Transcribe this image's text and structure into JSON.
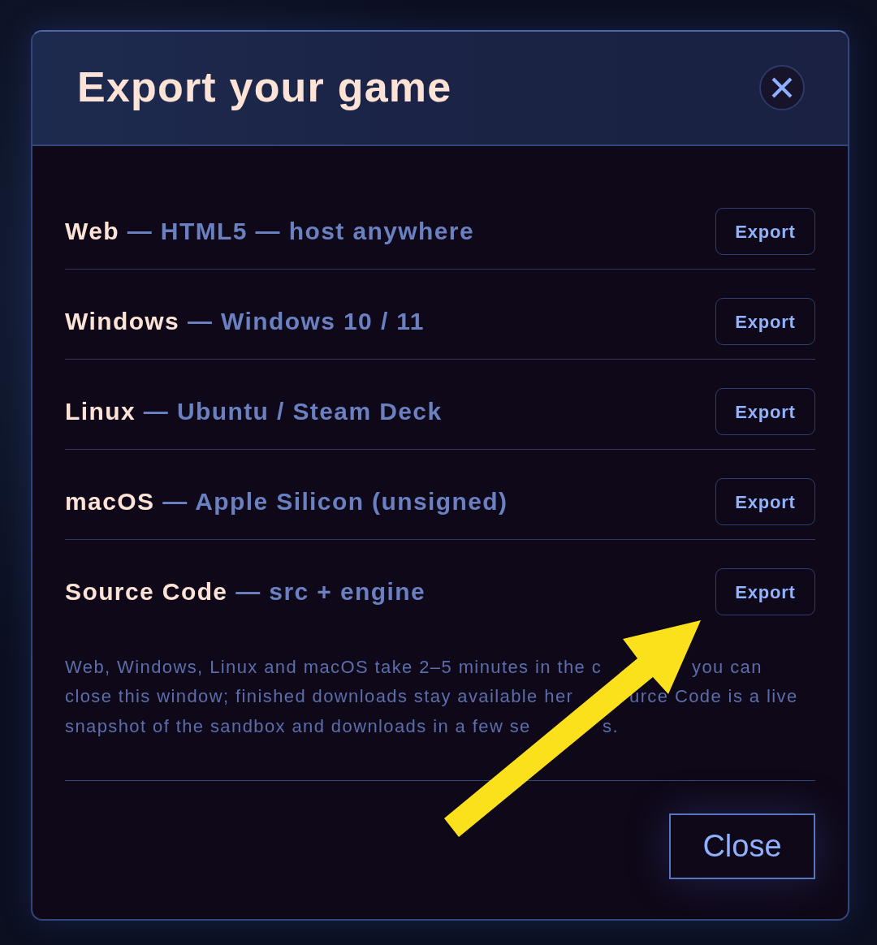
{
  "dialog": {
    "title": "Export your game"
  },
  "targets": [
    {
      "name": "Web",
      "detail": "— HTML5 — host anywhere",
      "action": "Export"
    },
    {
      "name": "Windows",
      "detail": "— Windows 10 / 11",
      "action": "Export"
    },
    {
      "name": "Linux",
      "detail": "— Ubuntu / Steam Deck",
      "action": "Export"
    },
    {
      "name": "macOS",
      "detail": "— Apple Silicon (unsigned)",
      "action": "Export"
    },
    {
      "name": "Source Code",
      "detail": "— src + engine",
      "action": "Export"
    }
  ],
  "note": {
    "lines": [
      [
        "Web, Windows, Linux and macOS take 2–5 minutes in the c",
        "you can"
      ],
      [
        "close this window; finished downloads stay available her",
        "urce Code is a live"
      ],
      [
        "snapshot of the sandbox and downloads in a few se",
        "s."
      ]
    ]
  },
  "footer": {
    "close_button": "Close"
  }
}
